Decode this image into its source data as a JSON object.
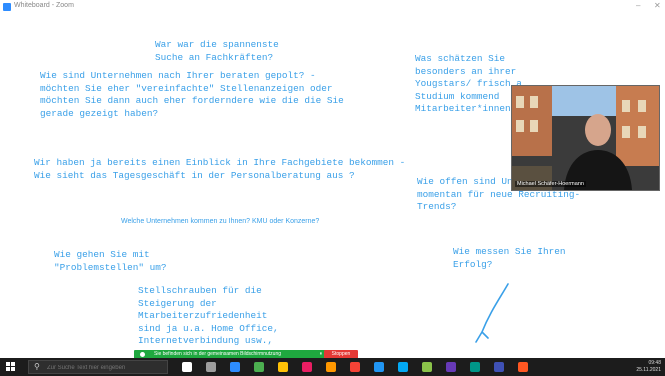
{
  "window": {
    "title": "Whiteboard - Zoom",
    "minimize": "–",
    "close": "✕"
  },
  "notes": {
    "spannendste": "War war die spannenste\nSuche an Fachkräften?",
    "beraten": "Wie sind Unternehmen nach Ihrer beraten gepolt? -\nmöchten Sie eher \"vereinfachte\" Stellenanzeigen oder\nmöchten Sie dann auch eher forderndere wie die die Sie\ngerade gezeigt haben?",
    "schaetzen": "Was schätzen Sie\nbesonders an ihrer\nYougstars/ frisch a\nStudium kommend\nMitarbeiter*innen?",
    "tagesgeschaeft": "Wir haben ja bereits einen Einblick in Ihre Fachgebiete bekommen -\nWie sieht das Tagesgeschäft in der Personalberatung aus ?",
    "recruiting": "Wie offen sind Unternehmen\nmomentan für neue Recruiting-\nTrends?",
    "unternehmen": "Welche Unternehmen kommen zu Ihnen? KMU oder Konzerne?",
    "problemstellen": "Wie gehen Sie mit\n\"Problemstellen\" um?",
    "erfolg": "Wie messen Sie Ihren\nErfolg?",
    "stellschrauben": "Stellschrauben für die\nSteigerung der\nMtarbeiterzufriedenheit\nsind ja u.a. Home Office,\nInternetverbindung usw.,"
  },
  "video": {
    "participant_name": "Michael Schäfer-Hoermann"
  },
  "share_bar": {
    "label": "Sie befinden sich in der gemeinsamen Bildschirmnutzung",
    "pause": "⏸",
    "stop_label": "Stoppen"
  },
  "taskbar": {
    "search_placeholder": "Zur Suche Text hier eingeben",
    "time": "09:48",
    "date": "25.11.2021",
    "icon_colors": [
      "#ffffff",
      "#9e9e9e",
      "#2d8cff",
      "#4caf50",
      "#ffc107",
      "#e91e63",
      "#ff9800",
      "#f44336",
      "#2196f3",
      "#03a9f4",
      "#8bc34a",
      "#673ab7",
      "#009688",
      "#3f51b5",
      "#ff5722"
    ]
  },
  "colors": {
    "ink": "#3aa0e8",
    "share_green": "#1fa83f",
    "stop_red": "#e53935",
    "taskbar": "#1c1c1c"
  }
}
